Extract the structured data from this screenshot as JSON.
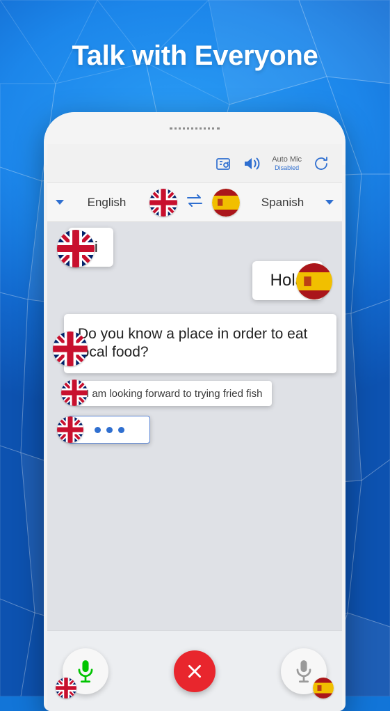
{
  "headline": "Talk with Everyone",
  "topbar": {
    "screenshot_icon": "screenshot-icon",
    "speaker_icon": "speaker-icon",
    "auto_mic_label": "Auto Mic",
    "auto_mic_status": "Disabled",
    "refresh_icon": "refresh-icon"
  },
  "language_bar": {
    "left_caret": "chevron-down-icon",
    "source_language": "English",
    "source_flag": "uk-flag",
    "swap_icon": "swap-icon",
    "target_flag": "spain-flag",
    "target_language": "Spanish",
    "right_caret": "chevron-down-icon"
  },
  "chat": {
    "messages": [
      {
        "text": "Hi",
        "side": "left",
        "flag": "uk-flag"
      },
      {
        "text": "Hola",
        "side": "right",
        "flag": "spain-flag"
      },
      {
        "text": "Do you know a place in order to eat local food?",
        "side": "left",
        "flag": "uk-flag"
      },
      {
        "text": "I am looking forward to trying fried fish",
        "side": "left",
        "flag": "uk-flag"
      },
      {
        "text": "",
        "side": "left",
        "flag": "uk-flag",
        "typing": true
      }
    ]
  },
  "bottom_bar": {
    "left_mic": {
      "icon": "microphone-icon",
      "flag": "uk-flag",
      "active": true
    },
    "close_button": {
      "icon": "close-icon"
    },
    "right_mic": {
      "icon": "microphone-icon",
      "flag": "spain-flag",
      "active": false
    }
  },
  "colors": {
    "background_blue": "#1275d8",
    "accent_blue": "#2f6fd0",
    "mic_active_green": "#00c400",
    "close_red": "#e8262d",
    "bubble_white": "#ffffff",
    "chat_bg": "#dfe1e6"
  }
}
